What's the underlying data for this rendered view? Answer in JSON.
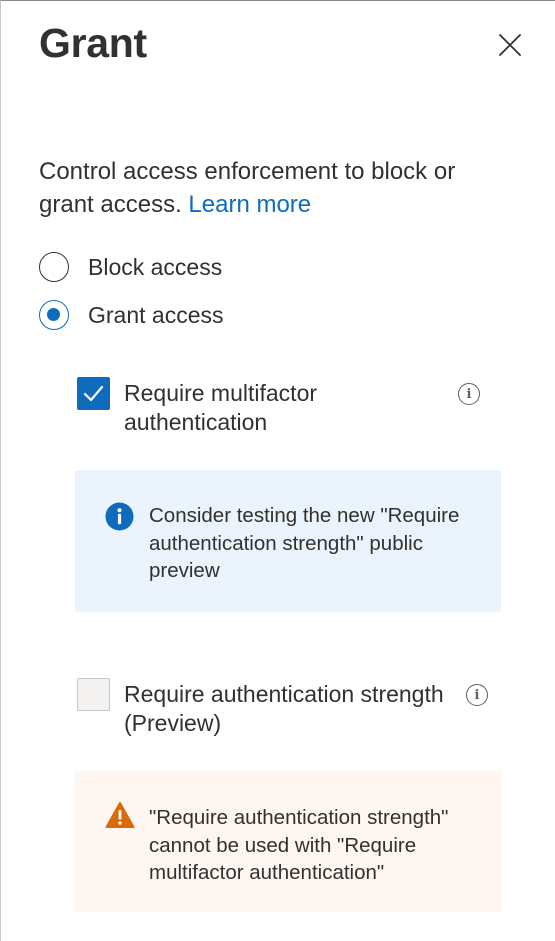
{
  "header": {
    "title": "Grant"
  },
  "description": {
    "text": "Control access enforcement to block or grant access.",
    "link_label": "Learn more"
  },
  "access_options": [
    {
      "label": "Block access",
      "selected": false
    },
    {
      "label": "Grant access",
      "selected": true
    }
  ],
  "controls": {
    "mfa": {
      "label": "Require multifactor authentication",
      "checked": true
    },
    "auth_strength": {
      "label": "Require authentication strength (Preview)",
      "checked": false
    }
  },
  "info_bar": {
    "message": "Consider testing the new \"Require authentication strength\" public preview"
  },
  "warning_bar": {
    "message": "\"Require authentication strength\" cannot be used with \"Require multifactor authentication\""
  },
  "colors": {
    "accent": "#0f6cbd",
    "info_bar_bg": "#ebf3fc",
    "warning_bar_bg": "#fdf6f1",
    "warning_icon": "#da6a0a"
  },
  "icons": {
    "close": "close-icon",
    "info": "info-circle-icon",
    "info_filled": "info-filled-icon",
    "warning": "warning-icon",
    "checkmark": "checkmark-icon"
  }
}
